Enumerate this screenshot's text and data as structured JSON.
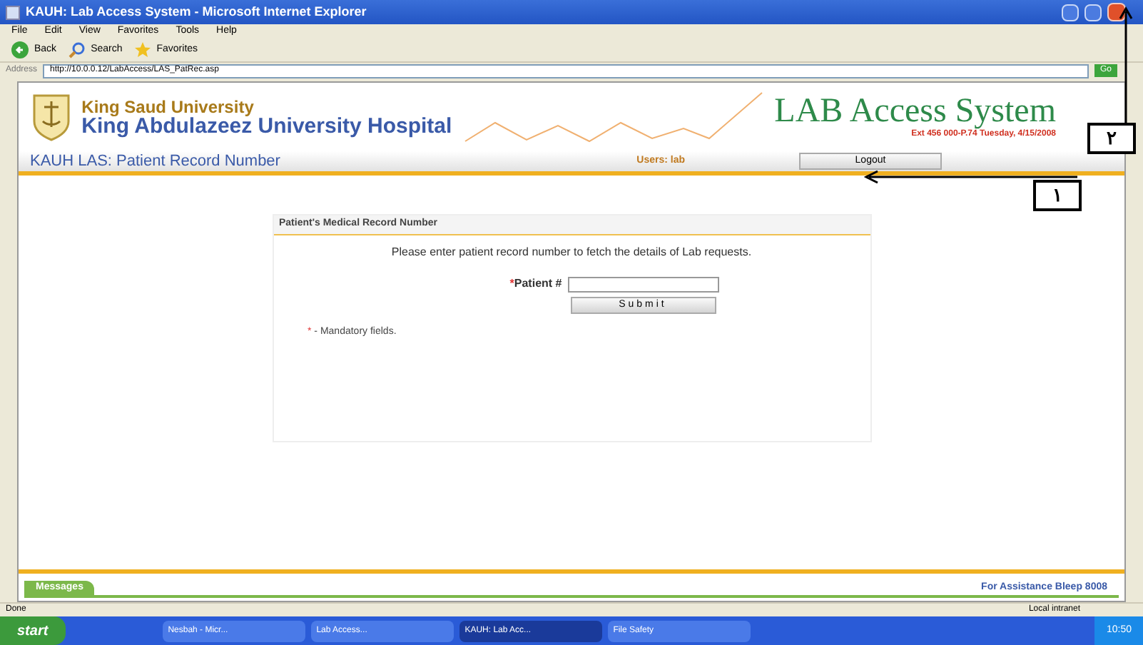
{
  "window": {
    "title": "KAUH: Lab Access System - Microsoft Internet Explorer"
  },
  "menu": [
    "File",
    "Edit",
    "View",
    "Favorites",
    "Tools",
    "Help"
  ],
  "toolbar": [
    {
      "kind": "back",
      "label": "Back"
    },
    {
      "kind": "search",
      "label": "Search"
    },
    {
      "kind": "favorites",
      "label": "Favorites"
    }
  ],
  "address": {
    "label": "Address",
    "url": "http://10.0.0.12/LabAccess/LAS_PatRec.asp",
    "go": "Go"
  },
  "header": {
    "line1": "King Saud University",
    "line2": "King Abdulazeez University Hospital",
    "system_title": "LAB Access System",
    "info_line": "Ext 456 000-P.74  Tuesday, 4/15/2008"
  },
  "nav": {
    "title": "KAUH LAS: Patient Record Number",
    "user": "Users: lab",
    "logout": "Logout"
  },
  "form": {
    "title": "Patient's Medical Record Number",
    "instruction": "Please enter patient record number to fetch the details of Lab requests.",
    "required_mark": "*",
    "field_label": "Patient #",
    "submit": "Submit",
    "note_mark": "*",
    "note": " - Mandatory fields."
  },
  "footer": {
    "messages": "Messages",
    "assistance": "For Assistance Bleep 8008"
  },
  "status_bar": {
    "left": "Done",
    "zone": "Local intranet"
  },
  "taskbar": {
    "start": "start",
    "tasks": [
      {
        "label": "Nesbah - Micr...",
        "selected": false
      },
      {
        "label": "Lab Access...",
        "selected": false
      },
      {
        "label": "KAUH: Lab Acc...",
        "selected": true
      },
      {
        "label": "File Safety",
        "selected": false
      }
    ],
    "clock": "10:50"
  },
  "annotations": [
    {
      "label": "٢"
    },
    {
      "label": "١"
    }
  ]
}
